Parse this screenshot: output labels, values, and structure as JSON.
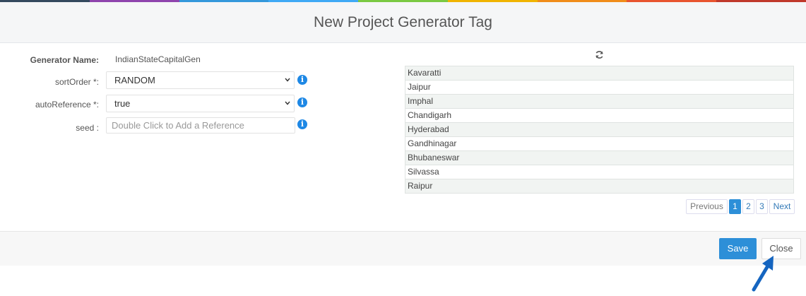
{
  "header": {
    "title": "New Project Generator Tag"
  },
  "colors": {
    "top_bar": [
      "#34495e",
      "#8e44ad",
      "#3498db",
      "#3fa9f5",
      "#7ac943",
      "#f0b400",
      "#f08c1a",
      "#e8542f",
      "#c0392b"
    ],
    "primary": "#2d8fd8",
    "info_icon": "#1e88e5"
  },
  "form": {
    "generator_name_label": "Generator Name:",
    "generator_name_value": "IndianStateCapitalGen",
    "sort_order_label": "sortOrder *:",
    "sort_order_value": "RANDOM",
    "auto_reference_label": "autoReference *:",
    "auto_reference_value": "true",
    "seed_label": "seed :",
    "seed_placeholder": "Double Click to Add a Reference"
  },
  "preview": {
    "refresh_icon": "refresh-icon",
    "rows": [
      "Kavaratti",
      "Jaipur",
      "Imphal",
      "Chandigarh",
      "Hyderabad",
      "Gandhinagar",
      "Bhubaneswar",
      "Silvassa",
      "Raipur"
    ]
  },
  "pagination": {
    "previous_label": "Previous",
    "pages": [
      "1",
      "2",
      "3"
    ],
    "active_page": "1",
    "next_label": "Next"
  },
  "footer": {
    "save_label": "Save",
    "close_label": "Close"
  }
}
